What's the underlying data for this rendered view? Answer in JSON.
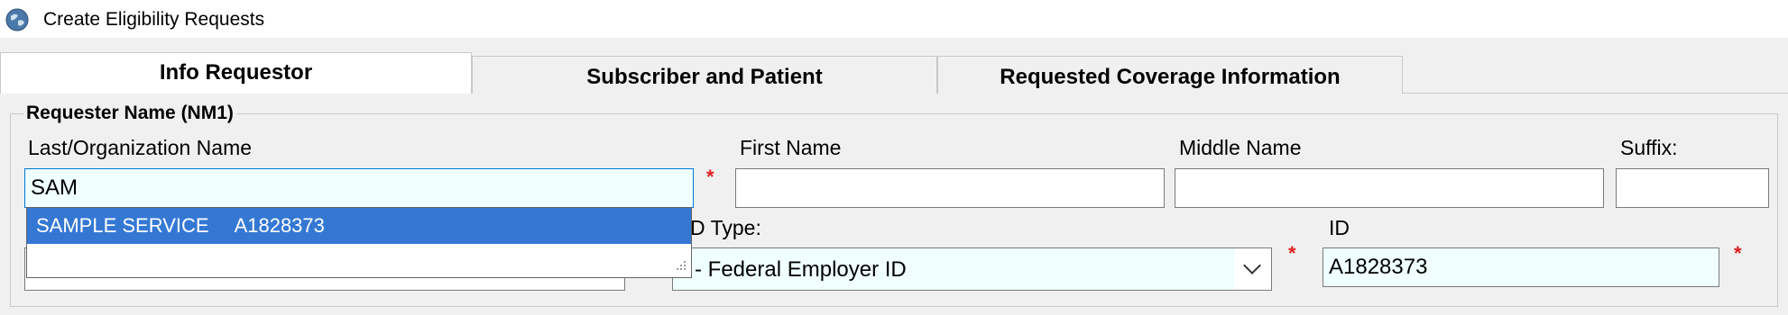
{
  "window": {
    "title": "Create Eligibility Requests",
    "icon": "globe-icon"
  },
  "tabs": [
    {
      "label": "Info Requestor",
      "active": true
    },
    {
      "label": "Subscriber and Patient",
      "active": false
    },
    {
      "label": "Requested Coverage Information",
      "active": false
    }
  ],
  "requester": {
    "group_title": "Requester Name (NM1)",
    "last_name": {
      "label": "Last/Organization Name",
      "value": "SAM",
      "required_mark": "*"
    },
    "first_name": {
      "label": "First Name",
      "value": ""
    },
    "middle_name": {
      "label": "Middle Name",
      "value": ""
    },
    "suffix": {
      "label": "Suffix:",
      "value": ""
    },
    "autocomplete": [
      {
        "name": "SAMPLE SERVICE",
        "id": "A1828373"
      }
    ],
    "id_type": {
      "label": "D Type:",
      "value": "4 - Federal Employer ID",
      "required_mark": "*"
    },
    "id": {
      "label": "ID",
      "value": "A1828373",
      "required_mark": "*"
    }
  },
  "colors": {
    "accent": "#0078d7",
    "selection": "#3478d4",
    "required": "#e02020",
    "field_bg": "#f0ffff"
  }
}
